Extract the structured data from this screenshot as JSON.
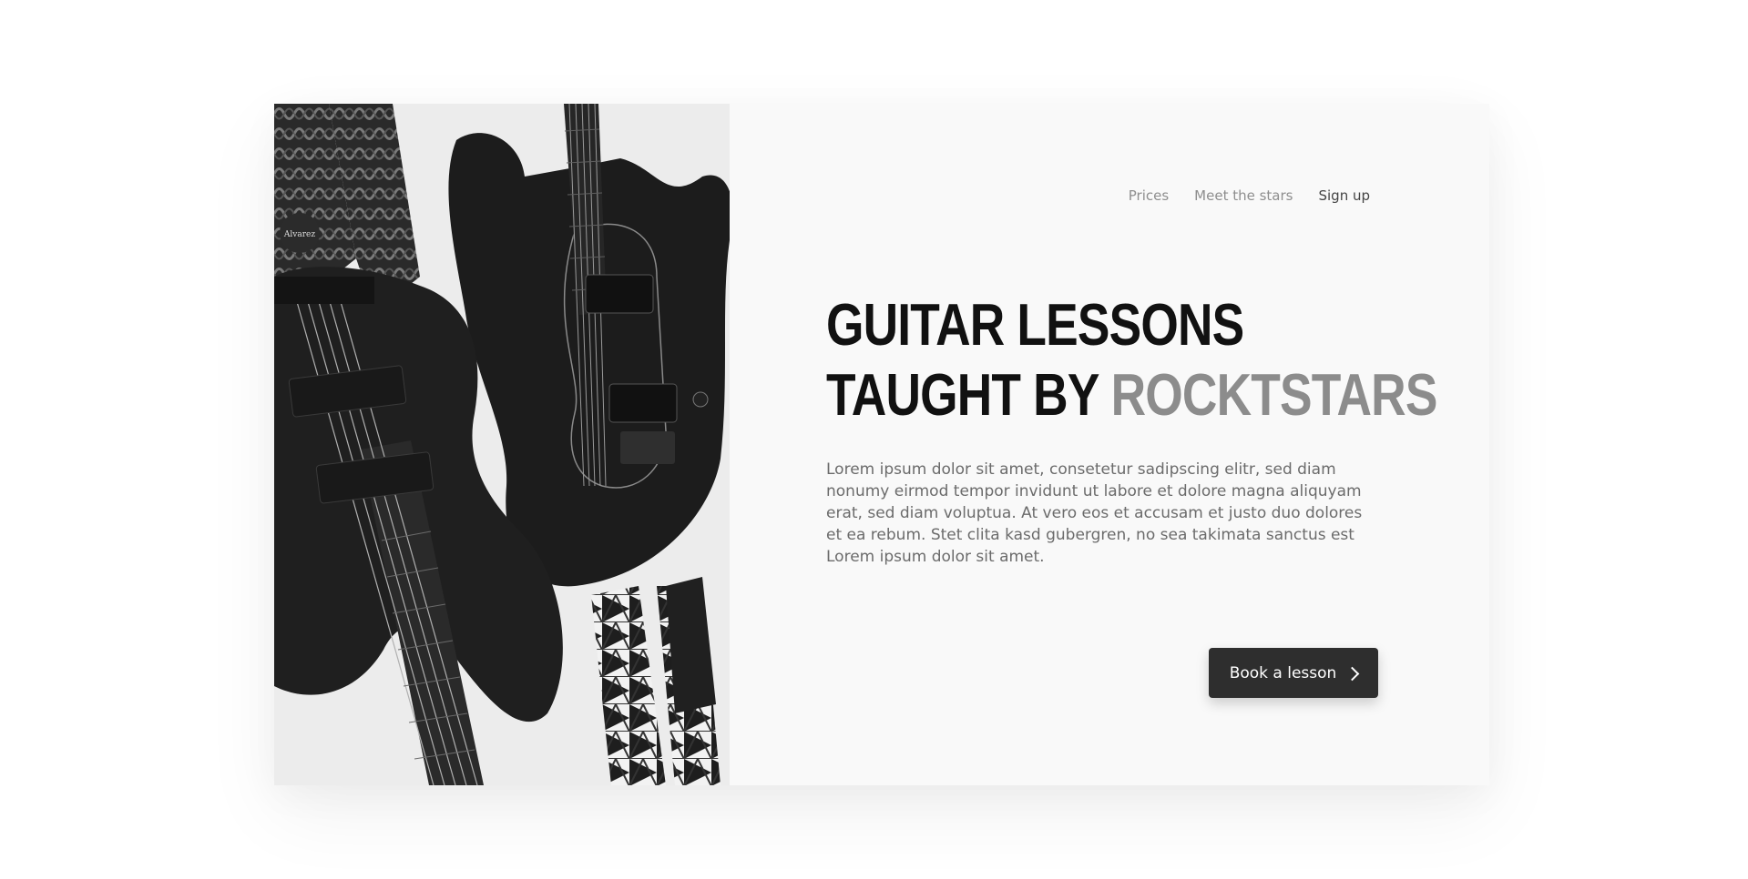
{
  "nav": {
    "items": [
      {
        "label": "Prices"
      },
      {
        "label": "Meet the stars"
      },
      {
        "label": "Sign up"
      }
    ]
  },
  "hero": {
    "headline_line1": "GUITAR LESSONS",
    "headline_line2_prefix": "TAUGHT BY ",
    "headline_line2_accent": "ROCKTSTARS",
    "body": "Lorem ipsum dolor sit amet, consetetur sadipscing elitr, sed diam nonumy eirmod tempor invidunt ut labore et dolore magna aliquyam erat, sed diam voluptua. At vero eos et accusam et justo duo dolores et ea rebum. Stet clita kasd gubergren, no sea takimata sanctus est Lorem ipsum dolor sit amet.",
    "cta_label": "Book a lesson",
    "cta_icon": "chevron-right-icon"
  },
  "photo": {
    "subject": "guitars-photo"
  },
  "colors": {
    "card_background": "#f9f9f9",
    "headline": "#111111",
    "headline_accent": "#8c8c8c",
    "body_text": "#6b6b6b",
    "nav_text": "#8e8e8e",
    "nav_active": "#444444",
    "button_background": "#2e2e2e"
  }
}
